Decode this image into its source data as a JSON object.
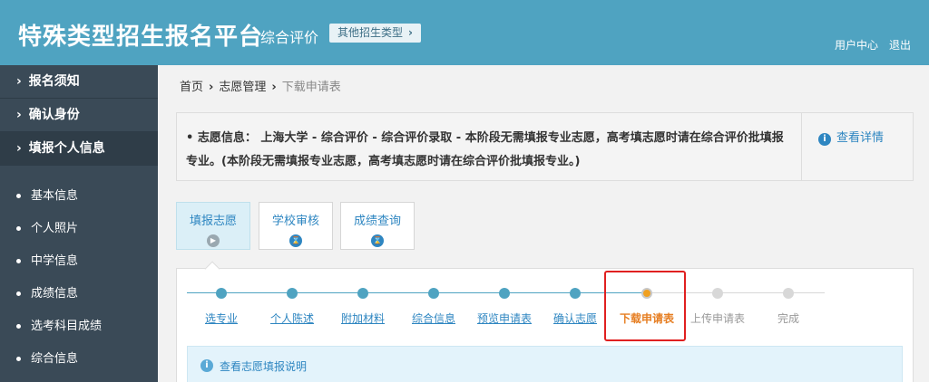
{
  "header": {
    "title": "特殊类型招生报名平台",
    "subtitle": "综合评价",
    "other_types": "其他招生类型",
    "user_center": "用户中心",
    "logout": "退出"
  },
  "sidebar": {
    "main_items": [
      {
        "label": "报名须知"
      },
      {
        "label": "确认身份"
      },
      {
        "label": "填报个人信息"
      }
    ],
    "sub_items": [
      {
        "label": "基本信息"
      },
      {
        "label": "个人照片"
      },
      {
        "label": "中学信息"
      },
      {
        "label": "成绩信息"
      },
      {
        "label": "选考科目成绩"
      },
      {
        "label": "综合信息"
      }
    ]
  },
  "breadcrumb": {
    "home": "首页",
    "section": "志愿管理",
    "current": "下载申请表"
  },
  "info": {
    "text": "志愿信息：  上海大学 - 综合评价 - 综合评价录取 - 本阶段无需填报专业志愿，高考填志愿时请在综合评价批填报专业。(本阶段无需填报专业志愿，高考填志愿时请在综合评价批填报专业。)",
    "detail_link": "查看详情"
  },
  "tabs": [
    {
      "label": "填报志愿",
      "icon": "play-icon"
    },
    {
      "label": "学校审核",
      "icon": "hourglass-icon"
    },
    {
      "label": "成绩查询",
      "icon": "hourglass-icon"
    }
  ],
  "steps": [
    {
      "label": "选专业",
      "state": "done"
    },
    {
      "label": "个人陈述",
      "state": "done"
    },
    {
      "label": "附加材料",
      "state": "done"
    },
    {
      "label": "综合信息",
      "state": "done"
    },
    {
      "label": "预览申请表",
      "state": "done"
    },
    {
      "label": "确认志愿",
      "state": "done"
    },
    {
      "label": "下载申请表",
      "state": "current"
    },
    {
      "label": "上传申请表",
      "state": "todo"
    },
    {
      "label": "完成",
      "state": "todo"
    }
  ],
  "tip": {
    "text": "查看志愿填报说明"
  },
  "colors": {
    "header_bg": "#4fa3c1",
    "sidebar_bg": "#3a4a57",
    "done": "#4fa3c1",
    "current": "#f0a020",
    "todo": "#d8d8d8",
    "highlight": "#e02020"
  }
}
